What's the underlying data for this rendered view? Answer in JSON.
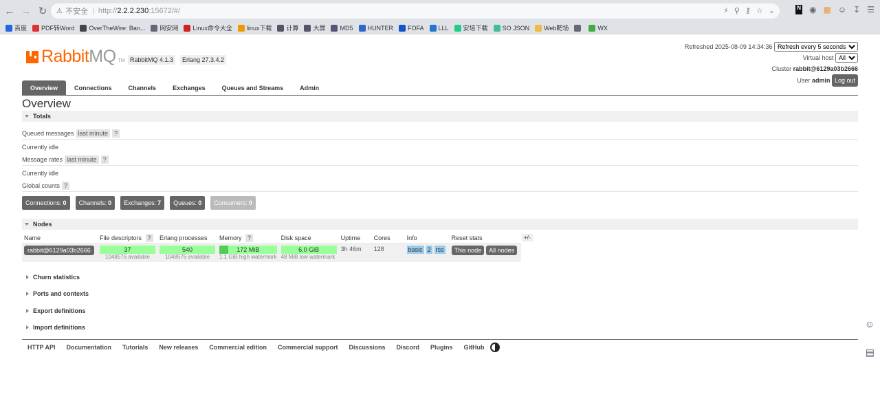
{
  "browser": {
    "security_label": "不安全",
    "url_proto": "http://",
    "url_host": "2.2.2.230",
    "url_rest": ":15672/#/",
    "bookmarks": [
      "百度",
      "PDF转Word",
      "OverTheWire: Ban...",
      "网安网",
      "Linux命令大全",
      "linux下载",
      "计算",
      "大屏",
      "MD5",
      "HUNTER",
      "FOFA",
      "LLL",
      "安培下载",
      "SO JSON",
      "Web靶场",
      "",
      "WX"
    ],
    "bookmark_colors": [
      "#2566e0",
      "#d33",
      "#444",
      "#667",
      "#c22",
      "#e90",
      "#556",
      "#556",
      "#557",
      "#36c",
      "#15c",
      "#27c",
      "#2c8",
      "#4b9",
      "#eb4",
      "#667",
      "#4a4"
    ]
  },
  "header": {
    "logo_rabbit": "Rabbit",
    "logo_mq": "MQ",
    "logo_tm": "TM",
    "rabbitmq_version": "RabbitMQ 4.1.3",
    "erlang_version": "Erlang 27.3.4.2",
    "refreshed_label": "Refreshed 2025-08-09 14:34:36",
    "refresh_select": "Refresh every 5 seconds",
    "vhost_label": "Virtual host",
    "vhost_select": "All",
    "cluster_label": "Cluster",
    "cluster_name": "rabbit@6129a03b2666",
    "user_label": "User",
    "user_name": "admin",
    "logout": "Log out"
  },
  "tabs": [
    "Overview",
    "Connections",
    "Channels",
    "Exchanges",
    "Queues and Streams",
    "Admin"
  ],
  "page_title": "Overview",
  "totals": {
    "section": "Totals",
    "queued_messages": "Queued messages",
    "queued_range": "last minute",
    "help": "?",
    "idle1": "Currently idle",
    "message_rates": "Message rates",
    "rates_range": "last minute",
    "idle2": "Currently idle",
    "global_counts": "Global counts"
  },
  "counts": [
    {
      "label": "Connections:",
      "value": "0"
    },
    {
      "label": "Channels:",
      "value": "0"
    },
    {
      "label": "Exchanges:",
      "value": "7"
    },
    {
      "label": "Queues:",
      "value": "0"
    },
    {
      "label": "Consumers:",
      "value": "0"
    }
  ],
  "nodes": {
    "section": "Nodes",
    "headers": [
      "Name",
      "File descriptors",
      "Erlang processes",
      "Memory",
      "Disk space",
      "Uptime",
      "Cores",
      "Info",
      "Reset stats"
    ],
    "help": "?",
    "plusminus": "+/-",
    "row": {
      "name": "rabbit@6129a03b2666",
      "fd_used": "37",
      "fd_avail": "1048576 available",
      "proc_used": "540",
      "proc_avail": "1048576 available",
      "mem_used": "172 MiB",
      "mem_fill": 0.15,
      "mem_watermark": "1.1 GiB high watermark",
      "disk_free": "6.0 GiB",
      "disk_watermark": "48 MiB low watermark",
      "uptime": "3h 46m",
      "cores": "128",
      "info_basic": "basic",
      "info_num": "2",
      "info_rss": "rss",
      "reset_this": "This node",
      "reset_all": "All nodes"
    }
  },
  "collapsed_sections": [
    "Churn statistics",
    "Ports and contexts",
    "Export definitions",
    "Import definitions"
  ],
  "footer": [
    "HTTP API",
    "Documentation",
    "Tutorials",
    "New releases",
    "Commercial edition",
    "Commercial support",
    "Discussions",
    "Discord",
    "Plugins",
    "GitHub"
  ]
}
